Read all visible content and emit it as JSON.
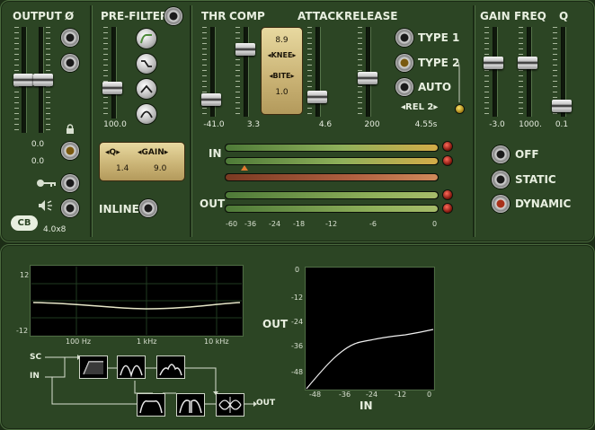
{
  "colors": {
    "panel": "#2c4524",
    "text": "#e8efe0",
    "meter_green": "#8fb05a",
    "meter_amber": "#d3ac48",
    "led_red": "#d23a28",
    "graph_line": "#e6e6c8"
  },
  "output": {
    "label": "OUTPUT",
    "phase_label": "Ø",
    "val_left": "0.0",
    "val_right": "0.0",
    "info": "4.0x8",
    "logo": "CB"
  },
  "prefilter": {
    "label": "PRE-FILTER",
    "freq": "100.0",
    "q_label": "Q",
    "gain_label": "GAIN",
    "q_val": "1.4",
    "gain_val": "9.0",
    "inline_label": "INLINE"
  },
  "comp": {
    "thr_label": "THR",
    "comp_label": "COMP",
    "attack_label": "ATTACK",
    "release_label": "RELEASE",
    "thr_val": "-41.0",
    "comp_val": "3.3",
    "attack_val": "4.6",
    "release_val": "200",
    "rel2_val": "4.55s",
    "knee_label": "KNEE",
    "knee_val": "8.9",
    "bite_label": "BITE",
    "bite_val": "1.0",
    "type1": "TYPE 1",
    "type2": "TYPE 2",
    "auto": "AUTO",
    "rel2": "REL 2",
    "in_label": "IN",
    "out_label": "OUT",
    "scale": [
      "-60",
      "-36",
      "-24",
      "-18",
      "-12",
      "-6",
      "0"
    ]
  },
  "eq": {
    "gain_label": "GAIN",
    "freq_label": "FREQ",
    "q_label": "Q",
    "gain_val": "-3.0",
    "freq_val": "1000.",
    "q_val": "0.1",
    "off": "OFF",
    "static": "STATIC",
    "dynamic": "DYNAMIC"
  },
  "graph": {
    "y_top": "12",
    "y_bottom": "-12",
    "x_ticks": [
      "100 Hz",
      "1 kHz",
      "10 kHz"
    ]
  },
  "routing": {
    "sc": "SC",
    "in": "IN",
    "out": "OUT"
  },
  "transfer": {
    "out_label": "OUT",
    "in_label": "IN",
    "y_ticks": [
      "0",
      "-12",
      "-24",
      "-36",
      "-48"
    ],
    "x_ticks": [
      "-48",
      "-36",
      "-24",
      "-12",
      "0"
    ]
  }
}
